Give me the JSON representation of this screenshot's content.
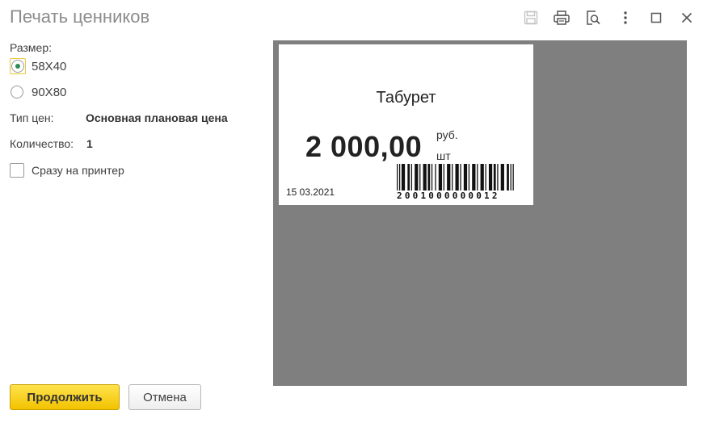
{
  "window": {
    "title": "Печать ценников"
  },
  "toolbar": {
    "icons": [
      "save-icon",
      "print-icon",
      "print-preview-icon",
      "more-icon",
      "maximize-icon",
      "close-icon"
    ]
  },
  "form": {
    "size_label": "Размер:",
    "size_options": [
      {
        "label": "58X40",
        "selected": true
      },
      {
        "label": "90X80",
        "selected": false
      }
    ],
    "price_type_label": "Тип цен:",
    "price_type_value": "Основная плановая цена",
    "quantity_label": "Количество:",
    "quantity_value": "1",
    "direct_print_label": "Сразу на принтер",
    "direct_print_checked": false
  },
  "preview": {
    "product_name": "Табурет",
    "price": "2 000,00",
    "currency": "руб.",
    "unit": "шт",
    "date": "15 03.2021",
    "barcode_digits": "2001000000012"
  },
  "buttons": {
    "continue": "Продолжить",
    "cancel": "Отмена"
  },
  "colors": {
    "primary_button": "#f2c200",
    "preview_background": "#7f7f7f",
    "radio_dot": "#2e8b57"
  }
}
